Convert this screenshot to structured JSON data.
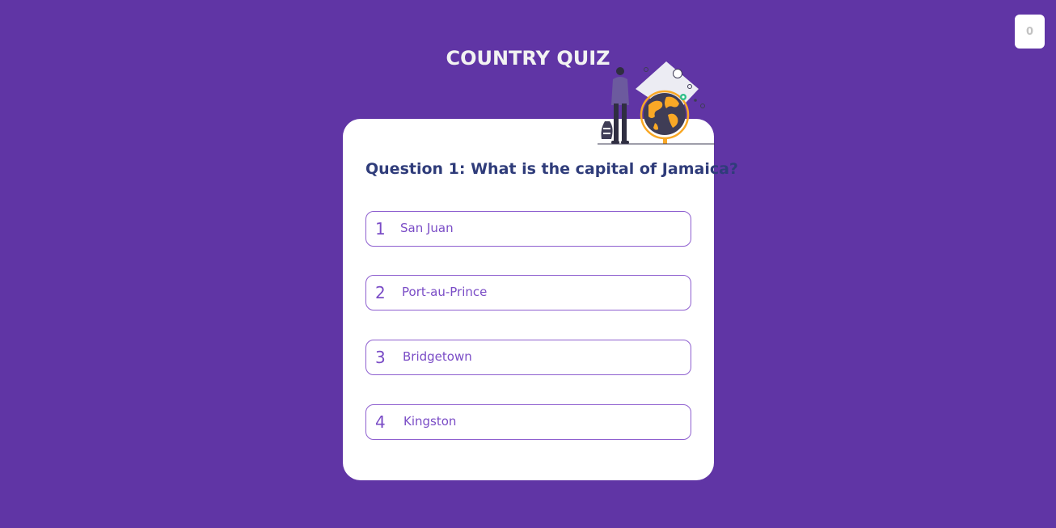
{
  "score": {
    "value": "0"
  },
  "header": {
    "title": "COUNTRY QUIZ"
  },
  "quiz": {
    "question": "Question 1: What is the capital of Jamaica?",
    "options": [
      {
        "number": "1",
        "label": "San Juan"
      },
      {
        "number": "2",
        "label": "Port-au-Prince"
      },
      {
        "number": "3",
        "label": "Bridgetown"
      },
      {
        "number": "4",
        "label": "Kingston"
      }
    ]
  },
  "colors": {
    "background": "#6035a5",
    "card": "#ffffff",
    "question_text": "#2f3c7a",
    "option_text": "#7a4cc6",
    "option_border": "#8e5fcf",
    "globe_accent": "#f9a826"
  },
  "illustration": {
    "icon": "traveler-with-globe-illustration"
  }
}
